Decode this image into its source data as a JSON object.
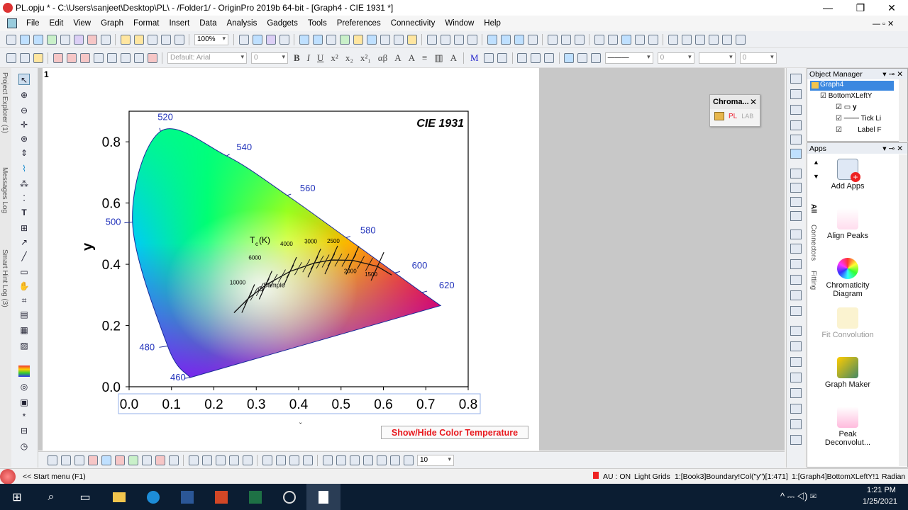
{
  "window": {
    "title": "PL.opju * - C:\\Users\\sanjeet\\Desktop\\PL\\ - /Folder1/ - OriginPro 2019b 64-bit - [Graph4 - CIE 1931 *]"
  },
  "menu": {
    "items": [
      "File",
      "Edit",
      "View",
      "Graph",
      "Format",
      "Insert",
      "Data",
      "Analysis",
      "Gadgets",
      "Tools",
      "Preferences",
      "Connectivity",
      "Window",
      "Help"
    ]
  },
  "toolbar": {
    "zoom": "100%",
    "font": "Default: Arial",
    "font_size": "0",
    "line_width": "0",
    "num2": "0",
    "bottom_num": "10"
  },
  "sidetabs": {
    "project_explorer": "Project Explorer (1)",
    "messages_log": "Messages Log",
    "smart_hint_log": "Smart Hint Log (3)"
  },
  "graph": {
    "page_number": "1",
    "title": "CIE 1931",
    "ylabel": "y",
    "xtick_labels": [
      "0.0",
      "0.1",
      "0.2",
      "0.3",
      "0.4",
      "0.5",
      "0.6",
      "0.7",
      "0.8"
    ],
    "ytick_labels": [
      "0.0",
      "0.2",
      "0.4",
      "0.6",
      "0.8"
    ],
    "wavelength_labels": [
      "520",
      "540",
      "560",
      "580",
      "600",
      "620",
      "500",
      "480",
      "460"
    ],
    "tc_label": "T",
    "tc_sub": "c",
    "tc_unit": "(K)",
    "temperature_labels": [
      "6000",
      "4000",
      "3000",
      "2500",
      "10000",
      "2000",
      "1500"
    ],
    "sample_label": "Sample",
    "button_label": "Show/Hide Color Temperature"
  },
  "chart_data": {
    "type": "scatter",
    "title": "CIE 1931",
    "xlabel": "",
    "ylabel": "y",
    "xlim": [
      0,
      0.8
    ],
    "ylim": [
      0,
      0.9
    ],
    "spectral_locus": [
      {
        "wavelength": 460,
        "x": 0.144,
        "y": 0.03
      },
      {
        "wavelength": 480,
        "x": 0.091,
        "y": 0.133
      },
      {
        "wavelength": 500,
        "x": 0.008,
        "y": 0.538
      },
      {
        "wavelength": 520,
        "x": 0.074,
        "y": 0.834
      },
      {
        "wavelength": 540,
        "x": 0.23,
        "y": 0.754
      },
      {
        "wavelength": 560,
        "x": 0.373,
        "y": 0.625
      },
      {
        "wavelength": 580,
        "x": 0.512,
        "y": 0.487
      },
      {
        "wavelength": 600,
        "x": 0.627,
        "y": 0.372
      },
      {
        "wavelength": 620,
        "x": 0.691,
        "y": 0.308
      }
    ],
    "planckian_locus": [
      {
        "temperature": "10000",
        "x": 0.281,
        "y": 0.288
      },
      {
        "temperature": "6000",
        "x": 0.322,
        "y": 0.332
      },
      {
        "temperature": "4000",
        "x": 0.38,
        "y": 0.377
      },
      {
        "temperature": "3000",
        "x": 0.437,
        "y": 0.404
      },
      {
        "temperature": "2500",
        "x": 0.477,
        "y": 0.414
      },
      {
        "temperature": "2000",
        "x": 0.527,
        "y": 0.413
      },
      {
        "temperature": "1500",
        "x": 0.586,
        "y": 0.393
      }
    ],
    "sample": {
      "label": "Sample",
      "x": 0.31,
      "y": 0.32
    }
  },
  "chroma_panel": {
    "title": "Chroma...",
    "pl": "PL",
    "lab": "LAB"
  },
  "object_manager": {
    "title": "Object Manager",
    "items": [
      "Graph4",
      "BottomXLeftY",
      "y",
      "Tick Li",
      "Label F"
    ]
  },
  "apps": {
    "title": "Apps",
    "tabs": [
      "All",
      "Connectors",
      "Fitting"
    ],
    "items": [
      "Add Apps",
      "Align Peaks",
      "Chromaticity Diagram",
      "Fit Convolution",
      "Graph Maker",
      "Peak Deconvolut..."
    ]
  },
  "status": {
    "start_menu": "<< Start menu (F1)",
    "au": "AU : ON",
    "light_grids": "Light Grids",
    "book": "1:[Book3]Boundary!Col(\"y\")[1:471]",
    "graph": "1:[Graph4]BottomXLeftY!1",
    "units": "Radian"
  },
  "taskbar": {
    "time": "1:21 PM",
    "date": "1/25/2021"
  }
}
